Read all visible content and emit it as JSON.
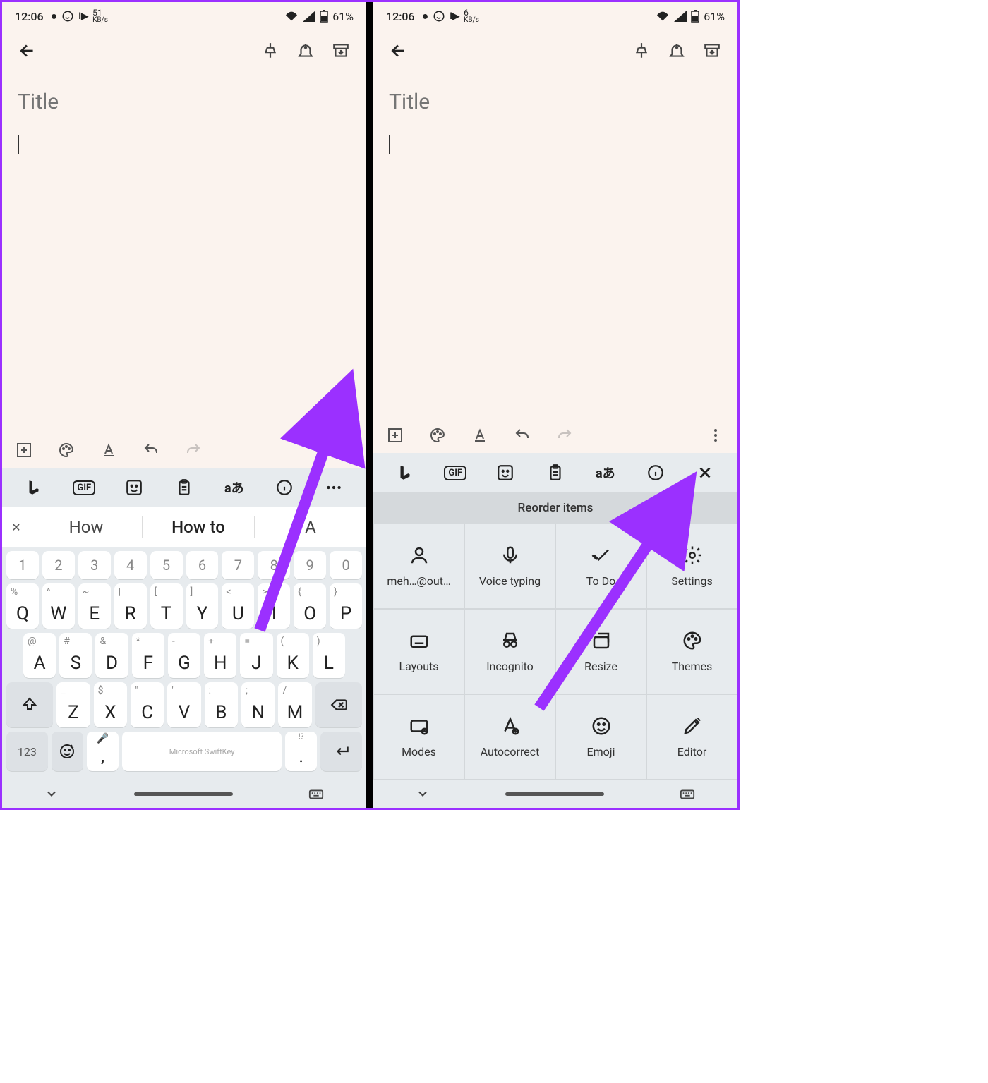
{
  "left": {
    "status": {
      "time": "12:06",
      "kb_rate": "51",
      "kb_unit": "KB/s",
      "battery": "61%"
    },
    "note": {
      "title_placeholder": "Title"
    },
    "suggestions": {
      "s1": "How",
      "s2": "How to",
      "s3": "A"
    },
    "keyboard": {
      "row1": [
        {
          "hint": "1",
          "k": "Q"
        },
        {
          "hint": "2",
          "k": "W"
        },
        {
          "hint": "3",
          "k": "E"
        },
        {
          "hint": "4",
          "k": "R"
        },
        {
          "hint": "5",
          "k": "T"
        },
        {
          "hint": "6",
          "k": "Y"
        },
        {
          "hint": "7",
          "k": "U"
        },
        {
          "hint": "8",
          "k": "I"
        },
        {
          "hint": "9",
          "k": "O"
        },
        {
          "hint": "0",
          "k": "P"
        }
      ],
      "row1_top": [
        "1",
        "2",
        "3",
        "4",
        "5",
        "6",
        "7",
        "8",
        "9",
        "0"
      ],
      "row2": [
        {
          "hint": "%",
          "k": "Q"
        },
        {
          "hint": "^",
          "k": "W"
        },
        {
          "hint": "~",
          "k": "E"
        },
        {
          "hint": "|",
          "k": "R"
        },
        {
          "hint": "[",
          "k": "T"
        },
        {
          "hint": "]",
          "k": "Y"
        },
        {
          "hint": "<",
          "k": "U"
        },
        {
          "hint": ">",
          "k": "I"
        },
        {
          "hint": "{",
          "k": "O"
        },
        {
          "hint": "}",
          "k": "P"
        }
      ],
      "row3": [
        {
          "hint": "@",
          "k": "A"
        },
        {
          "hint": "#",
          "k": "S"
        },
        {
          "hint": "&",
          "k": "D"
        },
        {
          "hint": "*",
          "k": "F"
        },
        {
          "hint": "-",
          "k": "G"
        },
        {
          "hint": "+",
          "k": "H"
        },
        {
          "hint": "=",
          "k": "J"
        },
        {
          "hint": "(",
          "k": "K"
        },
        {
          "hint": ")",
          "k": "L"
        }
      ],
      "row4": [
        {
          "hint": "_",
          "k": "Z"
        },
        {
          "hint": "$",
          "k": "X"
        },
        {
          "hint": "\"",
          "k": "C"
        },
        {
          "hint": "'",
          "k": "V"
        },
        {
          "hint": ":",
          "k": "B"
        },
        {
          "hint": ";",
          "k": "N"
        },
        {
          "hint": "/",
          "k": "M"
        }
      ],
      "space_label": "Microsoft SwiftKey",
      "num_label": "123"
    }
  },
  "right": {
    "status": {
      "time": "12:06",
      "kb_rate": "6",
      "kb_unit": "KB/s",
      "battery": "61%"
    },
    "note": {
      "title_placeholder": "Title"
    },
    "reorder": {
      "header": "Reorder items",
      "items": [
        {
          "label": "meh…@out…",
          "icon": "account"
        },
        {
          "label": "Voice typing",
          "icon": "mic"
        },
        {
          "label": "To Do",
          "icon": "check"
        },
        {
          "label": "Settings",
          "icon": "gear"
        },
        {
          "label": "Layouts",
          "icon": "keyboard"
        },
        {
          "label": "Incognito",
          "icon": "incognito"
        },
        {
          "label": "Resize",
          "icon": "resize"
        },
        {
          "label": "Themes",
          "icon": "palette"
        },
        {
          "label": "Modes",
          "icon": "modes"
        },
        {
          "label": "Autocorrect",
          "icon": "autocorrect"
        },
        {
          "label": "Emoji",
          "icon": "emoji"
        },
        {
          "label": "Editor",
          "icon": "pen"
        }
      ]
    }
  },
  "gif_label": "GIF",
  "translate_label": "aあ"
}
